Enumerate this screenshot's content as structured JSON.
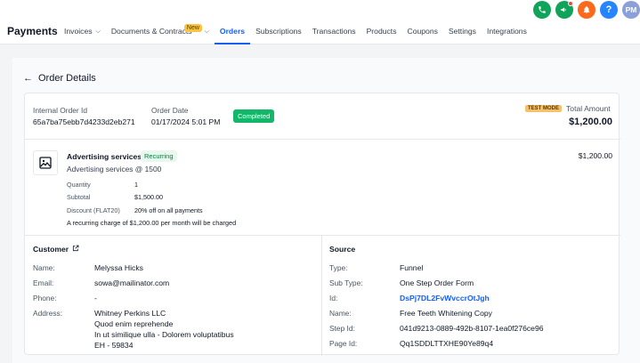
{
  "header": {
    "brand": "Payments",
    "nav": [
      {
        "label": "Invoices",
        "has_dropdown": true
      },
      {
        "label": "Documents & Contracts",
        "badge": "New",
        "has_dropdown": true
      },
      {
        "label": "Orders",
        "active": true
      },
      {
        "label": "Subscriptions"
      },
      {
        "label": "Transactions"
      },
      {
        "label": "Products"
      },
      {
        "label": "Coupons"
      },
      {
        "label": "Settings"
      },
      {
        "label": "Integrations"
      }
    ],
    "icons": [
      "phone-icon",
      "megaphone-icon",
      "bell-icon",
      "help-icon"
    ],
    "avatar_initials": "PM"
  },
  "page": {
    "back_label": "Order Details"
  },
  "order": {
    "internal_id_label": "Internal Order Id",
    "internal_id": "65a7ba75ebb7d4233d2eb271",
    "date_label": "Order Date",
    "date": "01/17/2024 5:01 PM",
    "status": "Completed",
    "mode_badge": "TEST MODE",
    "total_label": "Total Amount",
    "total": "$1,200.00"
  },
  "product": {
    "name": "Advertising services",
    "tag": "Recurring",
    "description": "Advertising services @ 1500",
    "price": "$1,200.00",
    "quantity_label": "Quantity",
    "quantity": "1",
    "subtotal_label": "Subtotal",
    "subtotal": "$1,500.00",
    "discount_label": "Discount (FLAT20)",
    "discount": "20% off on all payments",
    "recurring_note": "A recurring charge of $1,200.00 per month will be charged"
  },
  "customer": {
    "heading": "Customer",
    "name_label": "Name:",
    "name": "Melyssa Hicks",
    "email_label": "Email:",
    "email": "sowa@mailinator.com",
    "phone_label": "Phone:",
    "phone": "-",
    "address_label": "Address:",
    "address_lines": [
      "Whitney Perkins LLC",
      "Quod enim reprehende",
      "In ut similique ulla - Dolorem voluptatibus",
      "EH - 59834"
    ]
  },
  "source": {
    "heading": "Source",
    "type_label": "Type:",
    "type": "Funnel",
    "subtype_label": "Sub Type:",
    "subtype": "One Step Order Form",
    "id_label": "Id:",
    "id": "DsPj7DL2FvWvccrOtJgh",
    "name_label": "Name:",
    "name": "Free Teeth Whitening Copy",
    "step_label": "Step Id:",
    "step_id": "041d9213-0889-492b-8107-1ea0f276ce96",
    "page_label": "Page Id:",
    "page_id": "Qq1SDDLTTXHE90Ye89q4"
  },
  "colors": {
    "accent": "#155eef",
    "success": "#12b76a",
    "badge_yellow": "#f7c53f"
  }
}
